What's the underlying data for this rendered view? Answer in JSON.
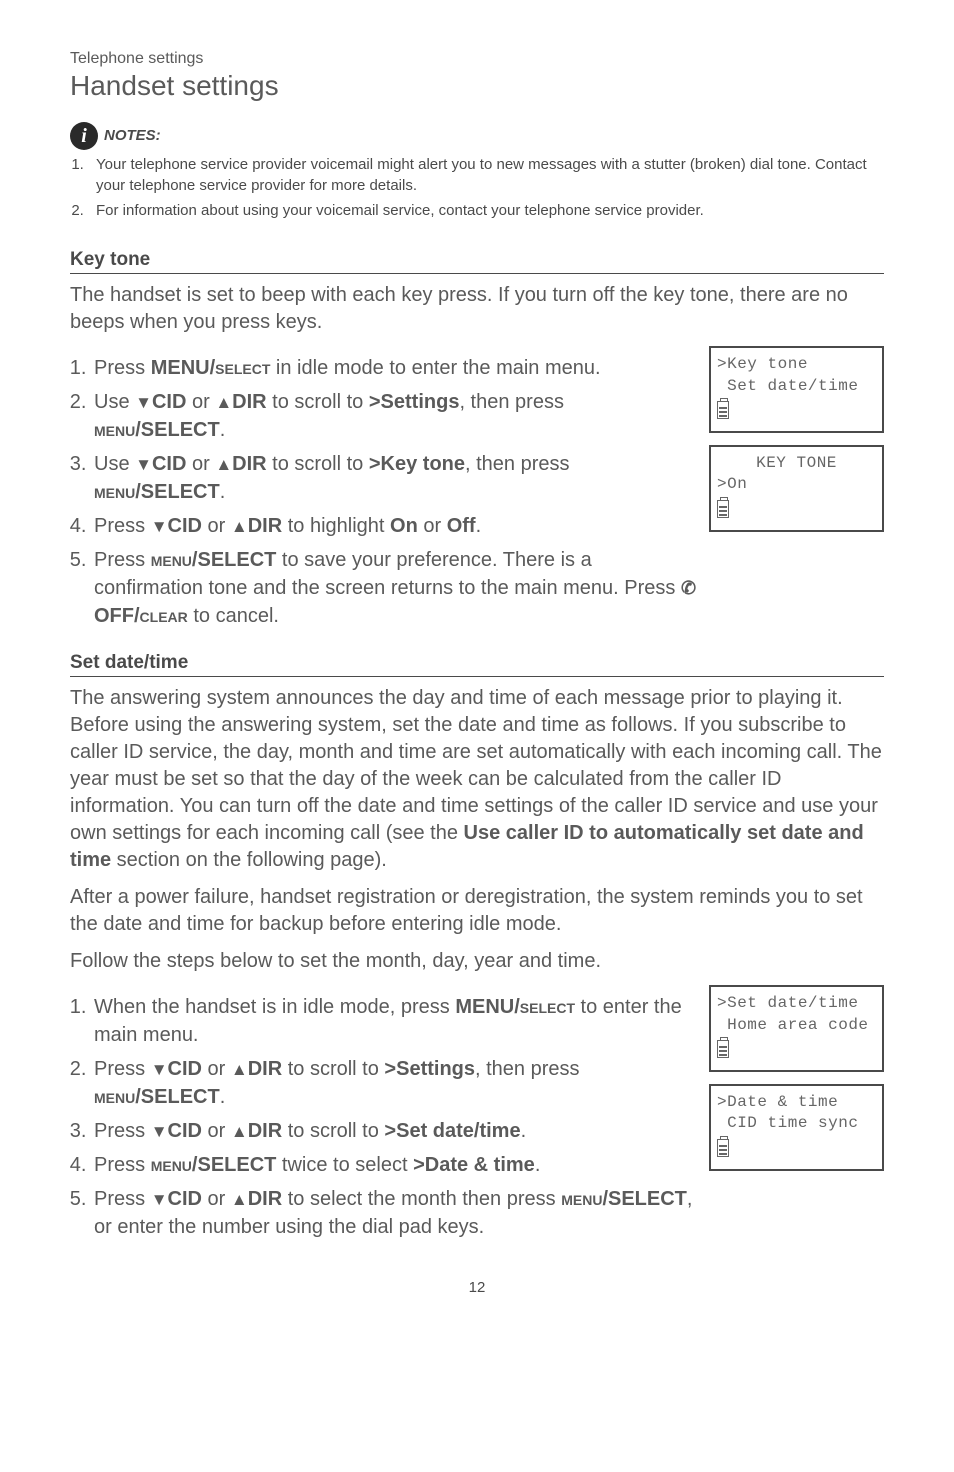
{
  "breadcrumb": "Telephone settings",
  "pageTitle": "Handset settings",
  "notesLabel": "NOTES:",
  "notes": [
    "Your telephone service provider voicemail might alert you to new messages with a stutter (broken) dial tone. Contact your telephone service provider for more details.",
    "For information about using your voicemail service, contact your telephone service provider."
  ],
  "keyTone": {
    "heading": "Key tone",
    "intro": "The handset is set to beep with each key press. If you turn off the key tone, there are no beeps when you press keys.",
    "steps": {
      "s1a": "Press ",
      "s1b": "MENU/",
      "s1c": "SELECT",
      "s1d": " in idle mode to enter the main menu.",
      "s2a": "Use ",
      "s2cid": "CID",
      "s2or": " or ",
      "s2dir": "DIR",
      "s2b": " to scroll to ",
      "s2settings": ">Settings",
      "s2c": ", then press ",
      "s2menu": "MENU",
      "s2select": "/SELECT",
      "s2d": ".",
      "s3a": "Use ",
      "s3b": " to scroll to ",
      "s3key": ">Key tone",
      "s3c": ", then press ",
      "s4a": "Press ",
      "s4b": " to highlight ",
      "s4on": "On",
      "s4or2": " or ",
      "s4off": "Off",
      "s4c": ".",
      "s5a": "Press ",
      "s5b": " to save your preference. There is a confirmation tone and the screen returns to the main menu. Press ",
      "s5off": " OFF/",
      "s5clear": "CLEAR",
      "s5c": " to cancel."
    },
    "lcd1": {
      "line1": ">Key tone",
      "line2": " Set date/time"
    },
    "lcd2": {
      "title": "KEY TONE",
      "line1": ">On"
    }
  },
  "setDate": {
    "heading": "Set date/time",
    "para1a": "The answering system announces the day and time of each message prior to playing it. Before using the answering system, set the date and time as follows. If you subscribe to caller ID service, the day, month and time are set automatically with each incoming call. The year must be set so that the day of the week can be calculated from the caller ID information. You can turn off the date and time settings of the caller ID service and use your own settings for each incoming call (see the ",
    "para1bold": "Use caller ID to automatically set date and time",
    "para1b": " section on the following page).",
    "para2": "After a power failure, handset registration or deregistration, the system reminds you to set the date and time for backup before entering idle mode.",
    "para3": "Follow the steps below to set the month, day, year and time.",
    "steps": {
      "s1a": "When the handset is in idle mode, press ",
      "s1b": " to enter the main menu.",
      "s2a": "Press ",
      "s2b": " to scroll to ",
      "s2c": ", then press ",
      "s3a": "Press ",
      "s3b": " to scroll to ",
      "s3target": ">Set date/time",
      "s3c": ".",
      "s4a": "Press ",
      "s4b": " twice to select ",
      "s4target": ">Date & time",
      "s4c": ".",
      "s5a": "Press ",
      "s5b": " to select the month then press ",
      "s5c": ", or enter the number using the dial pad keys."
    },
    "lcd1": {
      "line1": ">Set date/time",
      "line2": " Home area code"
    },
    "lcd2": {
      "line1": ">Date & time",
      "line2": " CID time sync"
    }
  },
  "pageNumber": "12"
}
